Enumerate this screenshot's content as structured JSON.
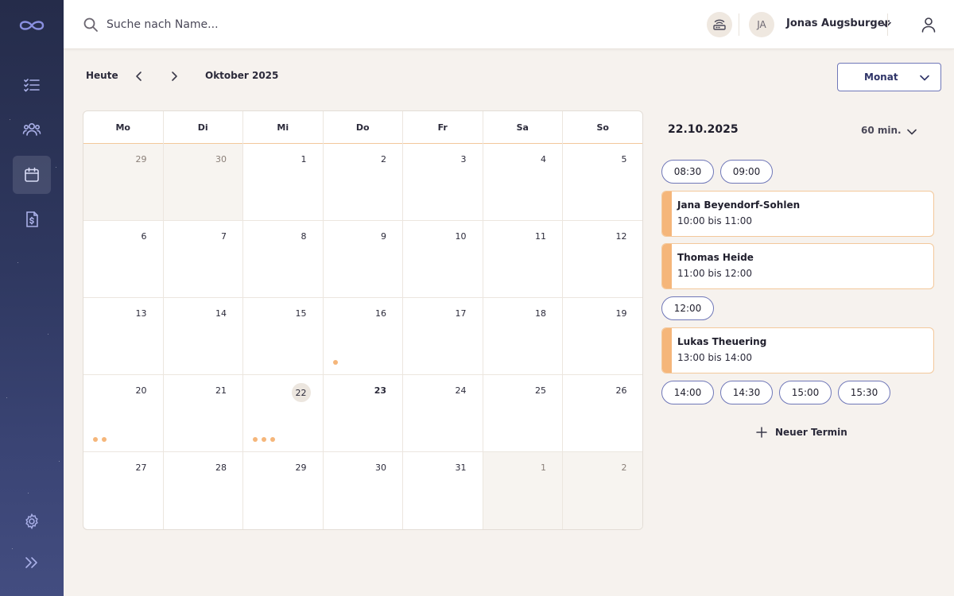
{
  "sidebar": {
    "logo": "infinity-logo",
    "items": [
      {
        "name": "tasks",
        "icon": "checklist-icon",
        "active": false
      },
      {
        "name": "patients",
        "icon": "users-icon",
        "active": false
      },
      {
        "name": "calendar",
        "icon": "calendar-icon",
        "active": true
      },
      {
        "name": "billing",
        "icon": "invoice-icon",
        "active": false
      }
    ],
    "settings_icon": "gear-icon",
    "expand_icon": "double-chevron-right-icon"
  },
  "header": {
    "search_placeholder": "Suche nach Name...",
    "avatar_initials": "JA",
    "user_name": "Jonas Augsburger"
  },
  "toolbar": {
    "today_label": "Heute",
    "month_label": "Oktober 2025",
    "view_label": "Monat"
  },
  "calendar": {
    "weekdays": [
      "Mo",
      "Di",
      "Mi",
      "Do",
      "Fr",
      "Sa",
      "So"
    ],
    "weeks": [
      [
        {
          "d": "29",
          "other": true
        },
        {
          "d": "30",
          "other": true
        },
        {
          "d": "1"
        },
        {
          "d": "2"
        },
        {
          "d": "3"
        },
        {
          "d": "4"
        },
        {
          "d": "5"
        }
      ],
      [
        {
          "d": "6"
        },
        {
          "d": "7"
        },
        {
          "d": "8"
        },
        {
          "d": "9"
        },
        {
          "d": "10"
        },
        {
          "d": "11"
        },
        {
          "d": "12"
        }
      ],
      [
        {
          "d": "13"
        },
        {
          "d": "14"
        },
        {
          "d": "15"
        },
        {
          "d": "16",
          "dots": 1
        },
        {
          "d": "17"
        },
        {
          "d": "18"
        },
        {
          "d": "19"
        }
      ],
      [
        {
          "d": "20",
          "dots": 2
        },
        {
          "d": "21"
        },
        {
          "d": "22",
          "selected": true,
          "dots": 3
        },
        {
          "d": "23",
          "bold": true
        },
        {
          "d": "24"
        },
        {
          "d": "25"
        },
        {
          "d": "26"
        }
      ],
      [
        {
          "d": "27"
        },
        {
          "d": "28"
        },
        {
          "d": "29"
        },
        {
          "d": "30"
        },
        {
          "d": "31"
        },
        {
          "d": "1",
          "other": true
        },
        {
          "d": "2",
          "other": true
        }
      ]
    ],
    "event_dot_color": "#f5b67a"
  },
  "day_panel": {
    "date": "22.10.2025",
    "duration": "60 min.",
    "slots_top": [
      "08:30",
      "09:00"
    ],
    "appointments": [
      {
        "name": "Jana Beyendorf-Sohlen",
        "time": "10:00 bis 11:00"
      },
      {
        "name": "Thomas Heide",
        "time": "11:00 bis 12:00"
      }
    ],
    "slots_mid": [
      "12:00"
    ],
    "appointments_2": [
      {
        "name": "Lukas Theuering",
        "time": "13:00 bis 14:00"
      }
    ],
    "slots_bottom": [
      "14:00",
      "14:30",
      "15:00",
      "15:30"
    ],
    "new_label": "Neuer Termin"
  },
  "colors": {
    "accent": "#6f77b8",
    "appointment": "#f5b67a",
    "sidebar": "#2f3860"
  }
}
